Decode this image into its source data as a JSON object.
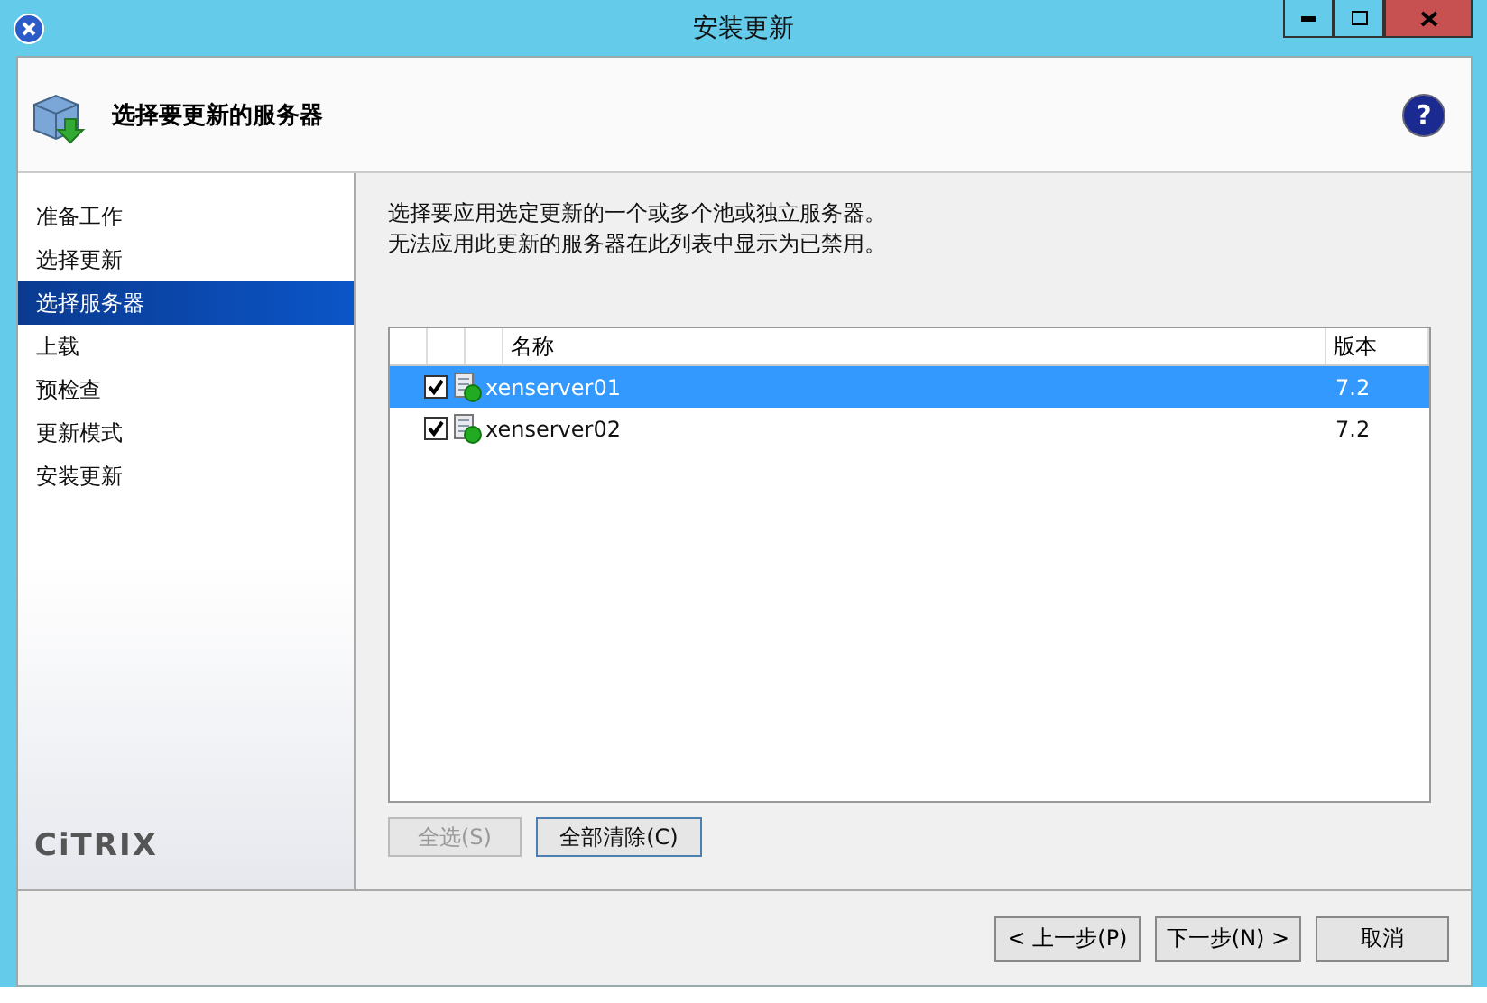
{
  "window": {
    "title": "安装更新"
  },
  "header": {
    "title": "选择要更新的服务器",
    "help": "?"
  },
  "sidebar": {
    "items": [
      {
        "label": "准备工作",
        "selected": false
      },
      {
        "label": "选择更新",
        "selected": false
      },
      {
        "label": "选择服务器",
        "selected": true
      },
      {
        "label": "上载",
        "selected": false
      },
      {
        "label": "预检查",
        "selected": false
      },
      {
        "label": "更新模式",
        "selected": false
      },
      {
        "label": "安装更新",
        "selected": false
      }
    ],
    "logo": "CiTRIX"
  },
  "instructions": [
    "选择要应用选定更新的一个或多个池或独立服务器。",
    "无法应用此更新的服务器在此列表中显示为已禁用。"
  ],
  "table": {
    "columns": [
      "名称",
      "版本"
    ],
    "rows": [
      {
        "name": "xenserver01",
        "version": "7.2",
        "checked": true,
        "selected": true
      },
      {
        "name": "xenserver02",
        "version": "7.2",
        "checked": true,
        "selected": false
      }
    ]
  },
  "list_buttons": [
    {
      "label": "全选(S)",
      "disabled": true
    },
    {
      "label": "全部清除(C)",
      "disabled": false
    }
  ],
  "footer_buttons": [
    {
      "label": "< 上一步(P)"
    },
    {
      "label": "下一步(N) >"
    },
    {
      "label": "取消"
    }
  ]
}
